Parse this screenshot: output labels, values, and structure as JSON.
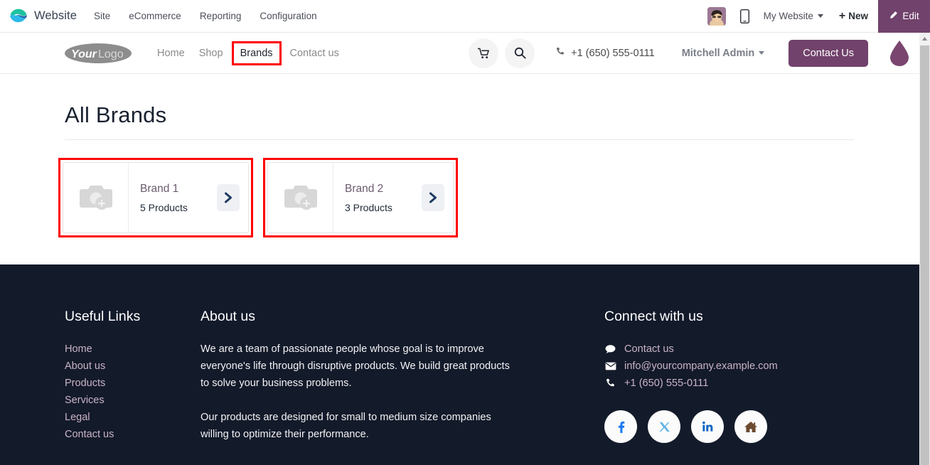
{
  "odoo_bar": {
    "app_name": "Website",
    "logo_icon": "odoo-website-logo",
    "menus": [
      "Site",
      "eCommerce",
      "Reporting",
      "Configuration"
    ],
    "avatar_icon": "user-avatar",
    "mobile_icon": "mobile-preview-icon",
    "website_selector": "My Website",
    "new_label": "New",
    "new_plus": "+",
    "edit_label": "Edit",
    "edit_icon": "pencil-icon",
    "edit_bg": "#71426b"
  },
  "site_header": {
    "logo_text_bold": "Your",
    "logo_text_light": "Logo",
    "nav": [
      {
        "label": "Home",
        "active": false
      },
      {
        "label": "Shop",
        "active": false
      },
      {
        "label": "Brands",
        "active": true,
        "highlighted": true
      },
      {
        "label": "Contact us",
        "active": false
      }
    ],
    "cart_icon": "shopping-cart-icon",
    "search_icon": "search-icon",
    "phone_icon": "phone-icon",
    "phone": "+1 (650) 555-0111",
    "user": "Mitchell Admin",
    "contact_button": "Contact Us",
    "droplet_icon": "theme-droplet-icon",
    "accent": "#71426b",
    "highlight_color": "#ff0000"
  },
  "main": {
    "title": "All Brands",
    "brands": [
      {
        "name": "Brand 1",
        "products": "5 Products",
        "thumb_icon": "image-placeholder-camera-icon",
        "arrow_icon": "chevron-right-icon",
        "highlighted": true
      },
      {
        "name": "Brand 2",
        "products": "3 Products",
        "thumb_icon": "image-placeholder-camera-icon",
        "arrow_icon": "chevron-right-icon",
        "highlighted": true
      }
    ]
  },
  "footer": {
    "bg": "#131a2a",
    "useful_links": {
      "title": "Useful Links",
      "items": [
        "Home",
        "About us",
        "Products",
        "Services",
        "Legal",
        "Contact us"
      ]
    },
    "about": {
      "title": "About us",
      "paragraph1": "We are a team of passionate people whose goal is to improve everyone's life through disruptive products. We build great products to solve your business problems.",
      "paragraph2": "Our products are designed for small to medium size companies willing to optimize their performance."
    },
    "connect": {
      "title": "Connect with us",
      "rows": [
        {
          "icon": "comment-icon",
          "text": "Contact us"
        },
        {
          "icon": "envelope-icon",
          "text": "info@yourcompany.example.com"
        },
        {
          "icon": "phone-icon",
          "text": "+1 (650) 555-0111"
        }
      ],
      "socials": [
        {
          "icon": "facebook-icon",
          "label": "f",
          "color": "#1877f2"
        },
        {
          "icon": "x-twitter-icon",
          "label": "X",
          "color": "#5eb3e4"
        },
        {
          "icon": "linkedin-icon",
          "label": "in",
          "color": "#0a66c2"
        },
        {
          "icon": "home-icon",
          "label": "home",
          "color": "#6b4a2f"
        }
      ]
    }
  },
  "scrollbar": {
    "up_arrow_icon": "scroll-up-arrow-icon"
  }
}
